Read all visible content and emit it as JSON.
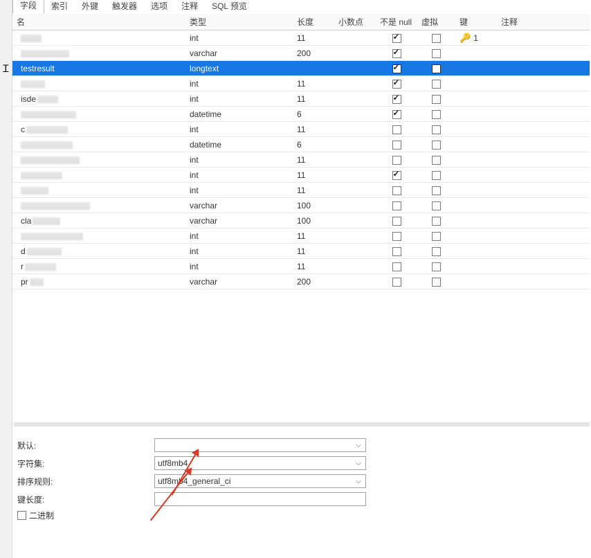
{
  "tabs": {
    "t0": "字段",
    "t1": "索引",
    "t2": "外键",
    "t3": "触发器",
    "t4": "选项",
    "t5": "注释",
    "t6": "SQL 预览"
  },
  "columns": {
    "name": "名",
    "type": "类型",
    "length": "长度",
    "decimals": "小数点",
    "notnull": "不是 null",
    "virtual": "虚拟",
    "key": "键",
    "comment": "注释"
  },
  "rows": [
    {
      "name": "",
      "visible_name": "",
      "smudge_w": 30,
      "type": "int",
      "len": "11",
      "dec": "",
      "notnull": true,
      "virt": false,
      "key": "1",
      "comment": ""
    },
    {
      "name": "",
      "visible_name": "",
      "smudge_w": 70,
      "type": "varchar",
      "len": "200",
      "dec": "",
      "notnull": true,
      "virt": false,
      "key": "",
      "comment": ""
    },
    {
      "name": "testresult",
      "visible_name": "testresult",
      "smudge_w": 0,
      "type": "longtext",
      "len": "",
      "dec": "",
      "notnull": true,
      "virt": false,
      "key": "",
      "comment": "",
      "selected": true
    },
    {
      "name": "",
      "visible_name": "",
      "smudge_w": 35,
      "type": "int",
      "len": "11",
      "dec": "",
      "notnull": true,
      "virt": false,
      "key": "",
      "comment": ""
    },
    {
      "name": "isde",
      "visible_name": "isde",
      "smudge_w": 30,
      "type": "int",
      "len": "11",
      "dec": "",
      "notnull": true,
      "virt": false,
      "key": "",
      "comment": ""
    },
    {
      "name": "",
      "visible_name": "",
      "smudge_w": 80,
      "type": "datetime",
      "len": "6",
      "dec": "",
      "notnull": true,
      "virt": false,
      "key": "",
      "comment": ""
    },
    {
      "name": "c",
      "visible_name": "c",
      "smudge_w": 60,
      "type": "int",
      "len": "11",
      "dec": "",
      "notnull": false,
      "virt": false,
      "key": "",
      "comment": ""
    },
    {
      "name": "",
      "visible_name": "",
      "smudge_w": 75,
      "type": "datetime",
      "len": "6",
      "dec": "",
      "notnull": false,
      "virt": false,
      "key": "",
      "comment": ""
    },
    {
      "name": "",
      "visible_name": "",
      "smudge_w": 85,
      "type": "int",
      "len": "11",
      "dec": "",
      "notnull": false,
      "virt": false,
      "key": "",
      "comment": ""
    },
    {
      "name": "",
      "visible_name": "",
      "smudge_w": 60,
      "type": "int",
      "len": "11",
      "dec": "",
      "notnull": true,
      "virt": false,
      "key": "",
      "comment": ""
    },
    {
      "name": "",
      "visible_name": "",
      "smudge_w": 40,
      "type": "int",
      "len": "11",
      "dec": "",
      "notnull": false,
      "virt": false,
      "key": "",
      "comment": ""
    },
    {
      "name": "",
      "visible_name": "",
      "smudge_w": 100,
      "type": "varchar",
      "len": "100",
      "dec": "",
      "notnull": false,
      "virt": false,
      "key": "",
      "comment": ""
    },
    {
      "name": "cla",
      "visible_name": "cla",
      "smudge_w": 40,
      "type": "varchar",
      "len": "100",
      "dec": "",
      "notnull": false,
      "virt": false,
      "key": "",
      "comment": ""
    },
    {
      "name": "",
      "visible_name": "",
      "smudge_w": 90,
      "type": "int",
      "len": "11",
      "dec": "",
      "notnull": false,
      "virt": false,
      "key": "",
      "comment": ""
    },
    {
      "name": "d",
      "visible_name": "d",
      "smudge_w": 50,
      "type": "int",
      "len": "11",
      "dec": "",
      "notnull": false,
      "virt": false,
      "key": "",
      "comment": ""
    },
    {
      "name": "r",
      "visible_name": "r",
      "smudge_w": 45,
      "type": "int",
      "len": "11",
      "dec": "",
      "notnull": false,
      "virt": false,
      "key": "",
      "comment": ""
    },
    {
      "name": "pr",
      "visible_name": "pr",
      "smudge_w": 20,
      "type": "varchar",
      "len": "200",
      "dec": "",
      "notnull": false,
      "virt": false,
      "key": "",
      "comment": ""
    }
  ],
  "props": {
    "default_label": "默认:",
    "default_val": "",
    "charset_label": "字符集:",
    "charset_val": "utf8mb4",
    "collation_label": "排序规则:",
    "collation_val": "utf8mb4_general_ci",
    "keylen_label": "键长度:",
    "keylen_val": "",
    "binary_label": "二进制"
  }
}
